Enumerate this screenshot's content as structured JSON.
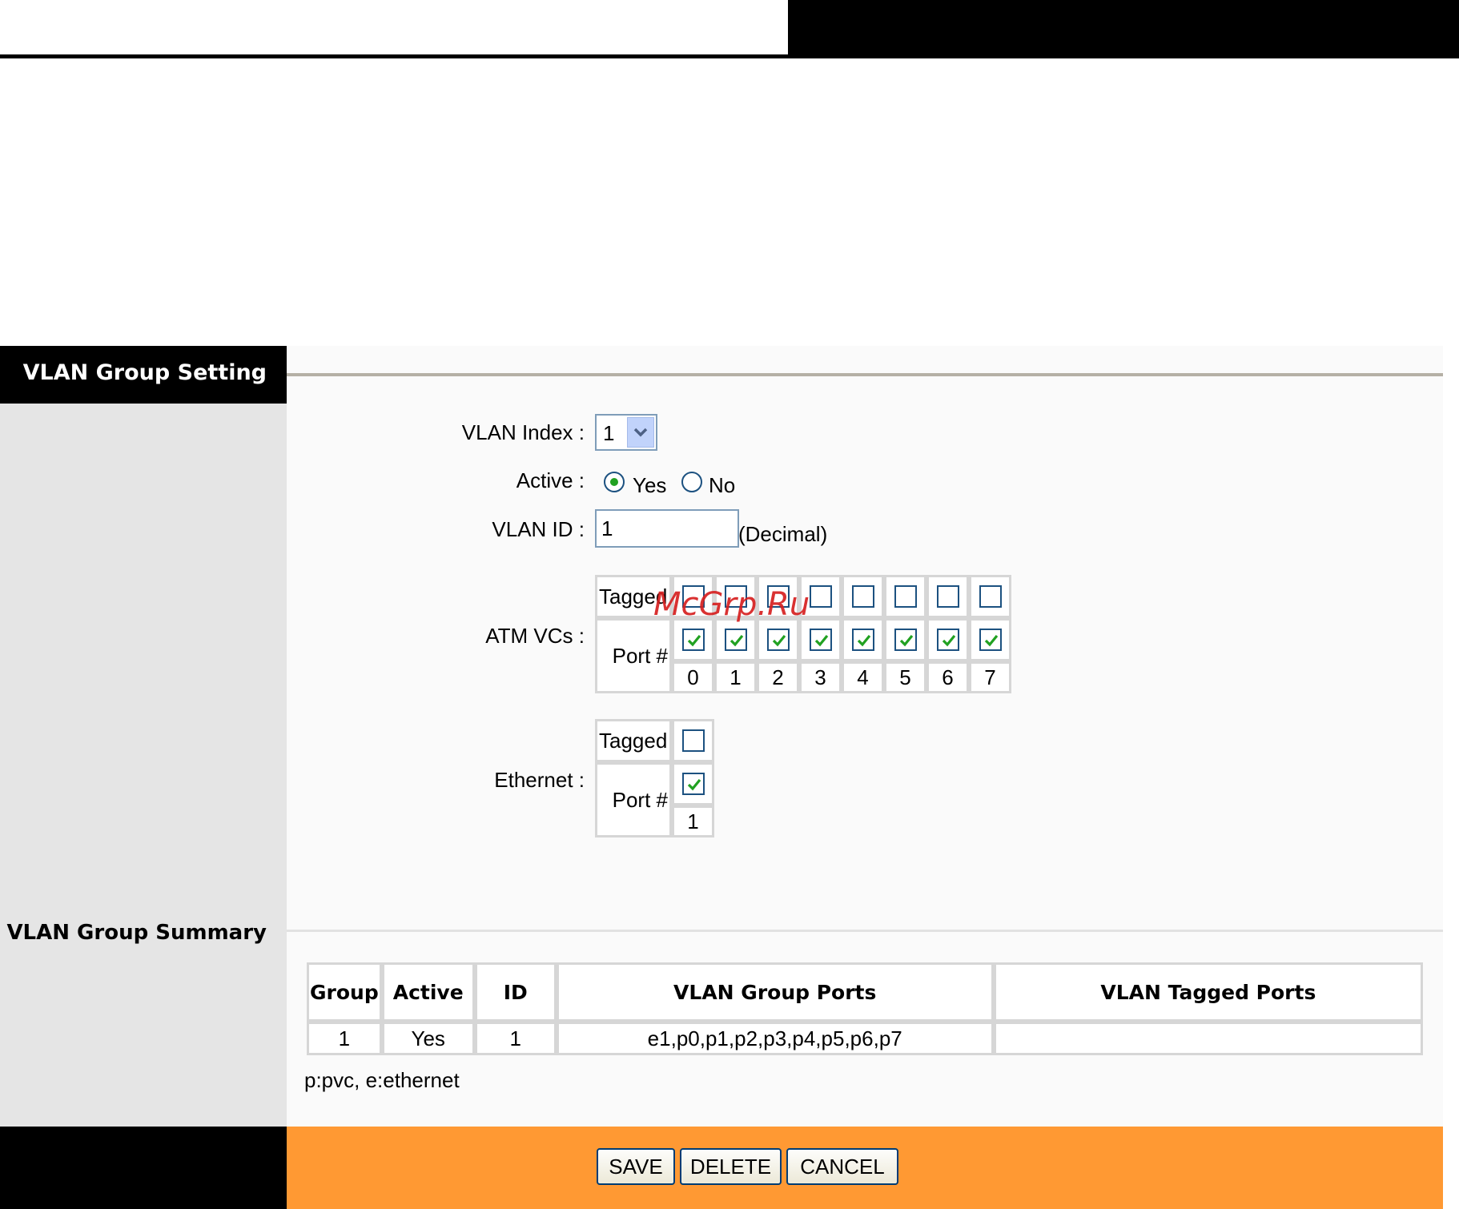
{
  "sidebar": {
    "section_title": "VLAN Group Setting",
    "summary_title": "VLAN Group Summary"
  },
  "form": {
    "vlan_index_label": "VLAN Index :",
    "vlan_index_value": "1",
    "active_label": "Active :",
    "active_yes": "Yes",
    "active_no": "No",
    "active_selected": "Yes",
    "vlan_id_label": "VLAN ID :",
    "vlan_id_value": "1",
    "vlan_id_unit": "(Decimal)",
    "atm_label": "ATM VCs :",
    "ethernet_label": "Ethernet :",
    "tagged_label": "Tagged",
    "port_label": "Port #"
  },
  "atm_ports": {
    "numbers": [
      "0",
      "1",
      "2",
      "3",
      "4",
      "5",
      "6",
      "7"
    ],
    "tagged": [
      false,
      false,
      false,
      false,
      false,
      false,
      false,
      false
    ],
    "member": [
      true,
      true,
      true,
      true,
      true,
      true,
      true,
      true
    ]
  },
  "ethernet_ports": {
    "numbers": [
      "1"
    ],
    "tagged": [
      false
    ],
    "member": [
      true
    ]
  },
  "summary": {
    "headers": [
      "Group",
      "Active",
      "ID",
      "VLAN Group Ports",
      "VLAN Tagged Ports"
    ],
    "rows": [
      [
        "1",
        "Yes",
        "1",
        "e1,p0,p1,p2,p3,p4,p5,p6,p7",
        ""
      ]
    ],
    "note": "p:pvc, e:ethernet"
  },
  "buttons": {
    "save": "SAVE",
    "delete": "DELETE",
    "cancel": "CANCEL"
  },
  "watermark": "McGrp.Ru",
  "colors": {
    "accent_orange": "#ff9933",
    "sidebar_gray": "#e5e5e5",
    "check_green": "#21a121",
    "control_border": "#1c5180"
  }
}
